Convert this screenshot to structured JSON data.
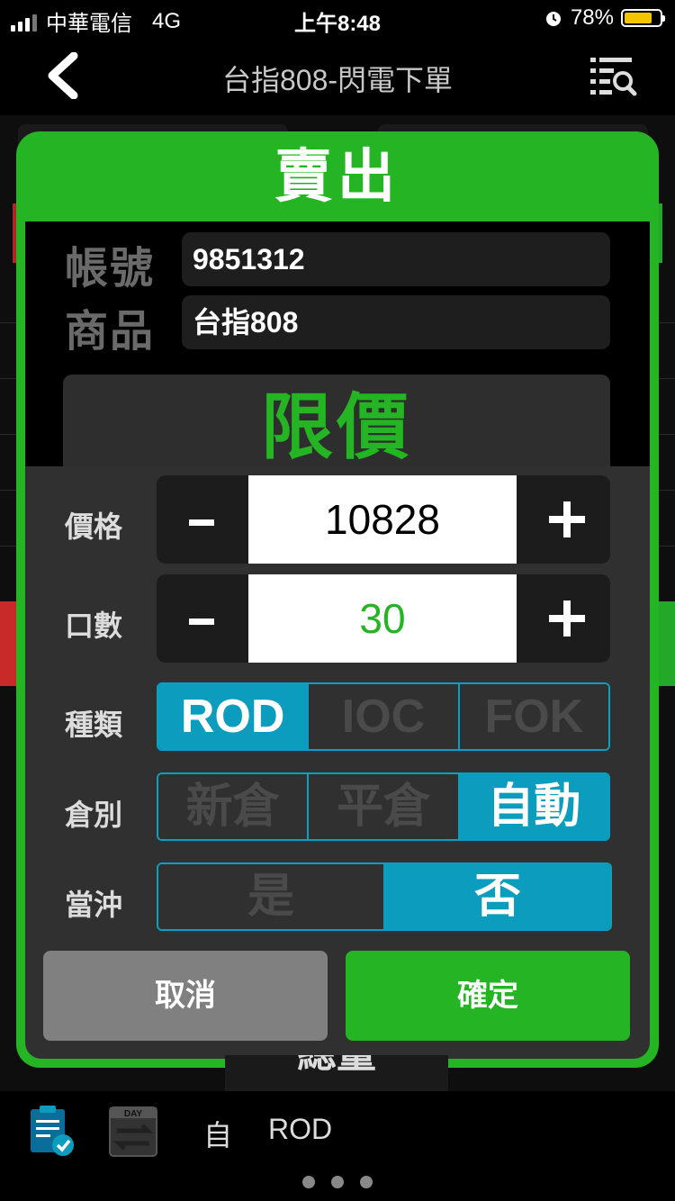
{
  "status_bar": {
    "carrier": "中華電信",
    "network": "4G",
    "time": "上午8:48",
    "battery": "78%",
    "battery_level": 0.78
  },
  "nav": {
    "title": "台指808-閃電下單",
    "back_icon": "chevron-left-icon",
    "menu_icon": "list-search-icon"
  },
  "dialog": {
    "title": "賣出",
    "account_label": "帳號",
    "account_value": "9851312",
    "product_label": "商品",
    "product_value": "台指808",
    "order_type_banner": "限價",
    "price": {
      "label": "價格",
      "minus": "-",
      "plus": "+",
      "value": "10828"
    },
    "quantity": {
      "label": "口數",
      "minus": "-",
      "plus": "+",
      "value": "30"
    },
    "kind": {
      "label": "種類",
      "options": [
        "ROD",
        "IOC",
        "FOK"
      ],
      "selected": "ROD"
    },
    "position": {
      "label": "倉別",
      "options": [
        "新倉",
        "平倉",
        "自動"
      ],
      "selected": "自動"
    },
    "daytrade": {
      "label": "當沖",
      "options": [
        "是",
        "否"
      ],
      "selected": "否"
    },
    "cancel": "取消",
    "confirm": "確定"
  },
  "background": {
    "partial_label": "總量"
  },
  "bottom_bar": {
    "order_icon": "clipboard-check-icon",
    "day_icon": "day-swap-icon",
    "day_badge": "DAY",
    "position_text": "自",
    "kind_text": "ROD",
    "page_count": 3
  },
  "colors": {
    "green": "#24b424",
    "cyan": "#0b9cbe",
    "battery": "#f5c400"
  }
}
